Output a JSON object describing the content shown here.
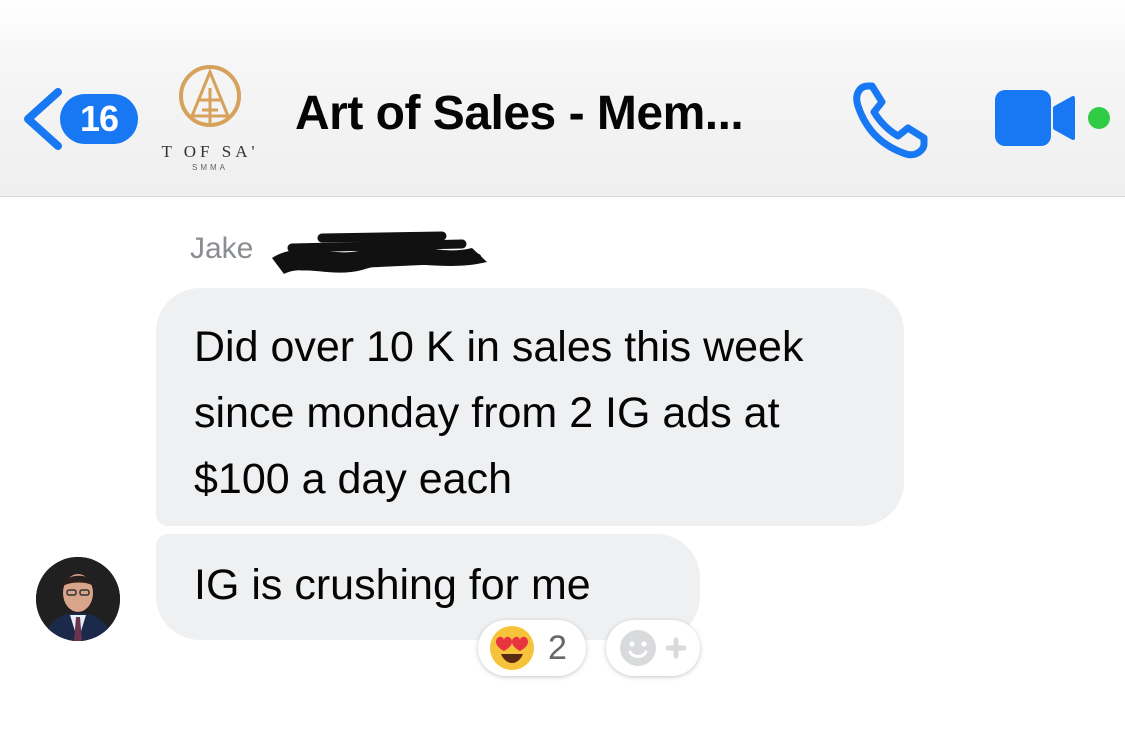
{
  "header": {
    "unread_count": "16",
    "title": "Art of Sales - Mem...",
    "logo_text": "T OF SA'",
    "logo_subtext": "SMMA",
    "accent": "#1877f2",
    "online_color": "#31cc46"
  },
  "messages": [
    {
      "sender": "Jake",
      "text": "Did over 10 K in sales this week since monday from 2 IG ads at $100 a day each"
    },
    {
      "text": "IG is crushing for me"
    }
  ],
  "reactions": {
    "emoji": "heart-eyes",
    "count": "2"
  }
}
